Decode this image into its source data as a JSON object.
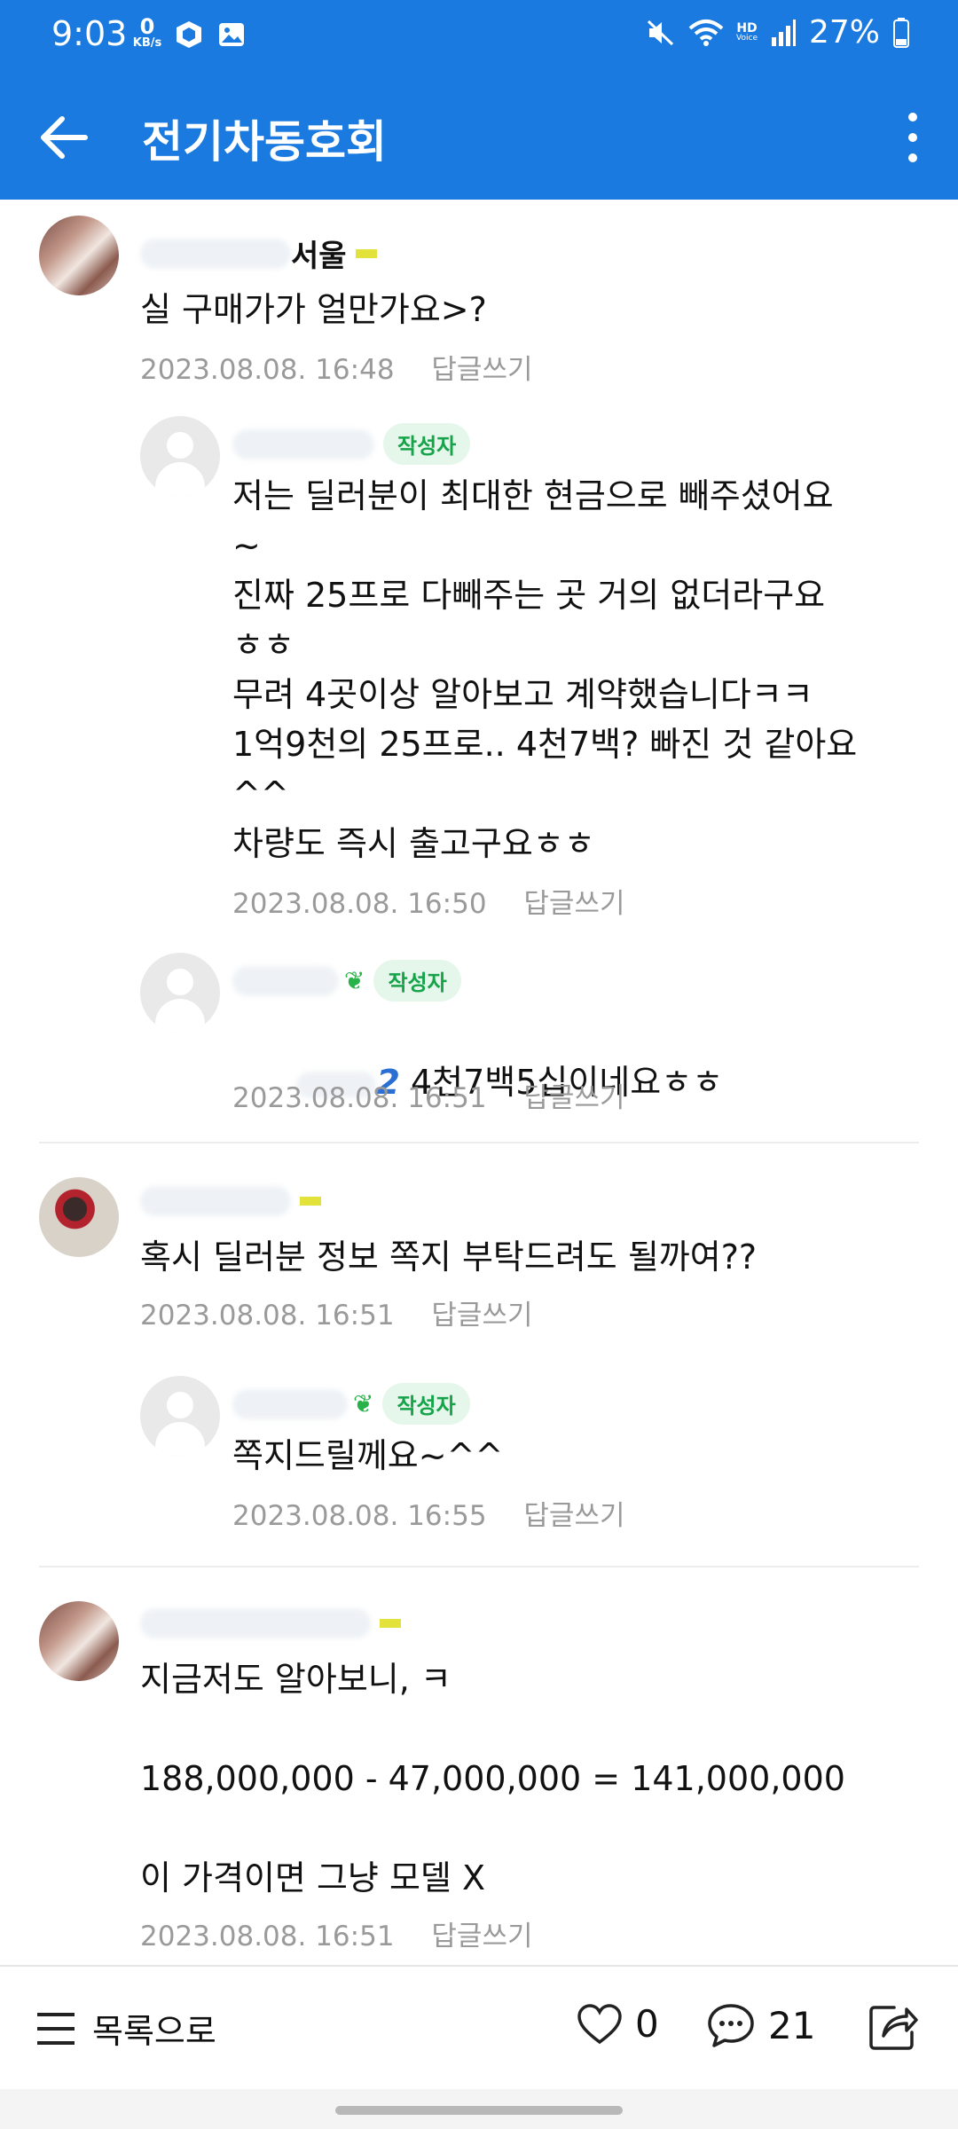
{
  "status_bar": {
    "time": "9:03",
    "net_speed_value": "0",
    "net_speed_unit": "KB/s",
    "hd_label": "HD",
    "hd_sub": "Voice",
    "battery": "27%"
  },
  "app_bar": {
    "title": "전기차동호회"
  },
  "comments": [
    {
      "author": "서울",
      "text": "실 구매가가 얼만가요>?",
      "date": "2023.08.08. 16:48",
      "reply_label": "답글쓰기"
    },
    {
      "author": "",
      "badge": "작성자",
      "text": "저는 딜러분이 최대한 현금으로 빼주셨어요\n~\n진짜 25프로 다빼주는 곳 거의 없더라구요\nㅎㅎ\n무려 4곳이상 알아보고 계약했습니다ㅋㅋ\n1억9천의 25프로.. 4천7백? 빠진 것 같아요\n^^\n차량도 즉시 출고구요ㅎㅎ",
      "date": "2023.08.08. 16:50",
      "reply_label": "답글쓰기"
    },
    {
      "author": "",
      "badge": "작성자",
      "mention": "2",
      "text": "4천7백5십이네요ㅎㅎ",
      "date": "2023.08.08. 16:51",
      "reply_label": "답글쓰기"
    },
    {
      "author": "",
      "text": "혹시 딜러분 정보 쪽지 부탁드려도 될까여??",
      "date": "2023.08.08. 16:51",
      "reply_label": "답글쓰기"
    },
    {
      "author": "",
      "badge": "작성자",
      "text": "쪽지드릴께요~^^",
      "date": "2023.08.08. 16:55",
      "reply_label": "답글쓰기"
    },
    {
      "author": "",
      "text": "지금저도 알아보니, ㅋ\n\n188,000,000 - 47,000,000 = 141,000,000\n\n이 가격이면 그냥 모델 X",
      "date": "2023.08.08. 16:51",
      "reply_label": "답글쓰기"
    }
  ],
  "bottom_bar": {
    "list_label": "목록으로",
    "like_count": "0",
    "comment_count": "21"
  },
  "colors": {
    "primary": "#1a7ae0",
    "badge_green": "#16a34a",
    "meta_gray": "#9a9a9a"
  }
}
